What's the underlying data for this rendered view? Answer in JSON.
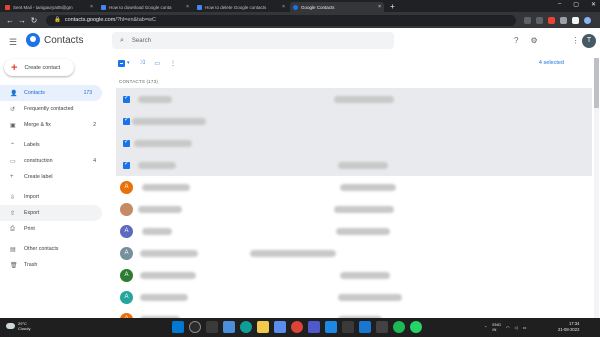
{
  "browser": {
    "tabs": [
      {
        "title": "Sent Mail - tanigaurya05@gm",
        "icon": "gmail-icon",
        "color": "#ea4335"
      },
      {
        "title": "How to download Google conta",
        "icon": "docs-icon",
        "color": "#4285f4"
      },
      {
        "title": "How to delete Google contacts",
        "icon": "docs-icon",
        "color": "#4285f4"
      },
      {
        "title": "Google Contacts",
        "icon": "contacts-icon",
        "color": "#1a73e8"
      }
    ],
    "url_domain": "contacts.google.com",
    "url_path": "/?hl=en&tab=wC",
    "new_tab": "+",
    "close": "×"
  },
  "header": {
    "app_name": "Contacts",
    "search_placeholder": "Search",
    "avatar_letter": "T"
  },
  "create_label": "Create contact",
  "sidebar": {
    "contacts": {
      "label": "Contacts",
      "count": "173"
    },
    "frequent": {
      "label": "Frequently contacted"
    },
    "merge": {
      "label": "Merge & fix",
      "count": "2"
    },
    "labels_heading": "Labels",
    "construction": {
      "label": "construction",
      "count": "4"
    },
    "create_label": "Create label",
    "import": "Import",
    "export": "Export",
    "print": "Print",
    "other": "Other contacts",
    "trash": "Trash"
  },
  "main": {
    "selected_text": "4 selected",
    "column_header": "CONTACTS (173)",
    "rows": [
      {
        "type": "checked"
      },
      {
        "type": "checked"
      },
      {
        "type": "checked"
      },
      {
        "type": "checked"
      },
      {
        "type": "avatar",
        "letter": "A",
        "color": "#e8710a"
      },
      {
        "type": "photo",
        "color": "#c58b62"
      },
      {
        "type": "avatar",
        "letter": "A",
        "color": "#5c6bc0"
      },
      {
        "type": "avatar",
        "letter": "A",
        "color": "#78909c"
      },
      {
        "type": "avatar",
        "letter": "A",
        "color": "#2e7d32"
      },
      {
        "type": "avatar",
        "letter": "A",
        "color": "#26a69a"
      },
      {
        "type": "avatar",
        "letter": "A",
        "color": "#e8710a"
      }
    ]
  },
  "taskbar": {
    "temp": "29°C",
    "weather": "Cloudy",
    "lang1": "ENG",
    "lang2": "IN",
    "time": "17:34",
    "date": "21-08-2022"
  }
}
